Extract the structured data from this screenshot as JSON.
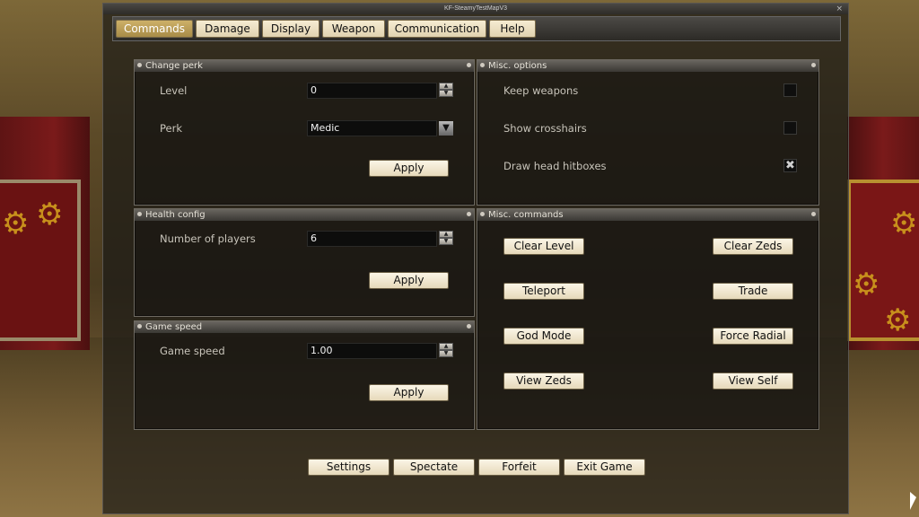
{
  "window": {
    "title": "KF-SteamyTestMapV3",
    "close_glyph": "×"
  },
  "tabs": [
    {
      "label": "Commands",
      "active": true
    },
    {
      "label": "Damage"
    },
    {
      "label": "Display"
    },
    {
      "label": "Weapon"
    },
    {
      "label": "Communication"
    },
    {
      "label": "Help"
    }
  ],
  "change_perk": {
    "title": "Change perk",
    "level_label": "Level",
    "level_value": "0",
    "perk_label": "Perk",
    "perk_value": "Medic",
    "apply_label": "Apply"
  },
  "health_config": {
    "title": "Health config",
    "players_label": "Number of players",
    "players_value": "6",
    "apply_label": "Apply"
  },
  "game_speed": {
    "title": "Game speed",
    "speed_label": "Game speed",
    "speed_value": "1.00",
    "apply_label": "Apply"
  },
  "misc_options": {
    "title": "Misc. options",
    "items": [
      {
        "label": "Keep weapons",
        "checked": false,
        "mark": ""
      },
      {
        "label": "Show crosshairs",
        "checked": false,
        "mark": ""
      },
      {
        "label": "Draw head hitboxes",
        "checked": true,
        "mark": "✖"
      }
    ]
  },
  "misc_commands": {
    "title": "Misc. commands",
    "buttons": [
      "Clear Level",
      "Clear Zeds",
      "Teleport",
      "Trade",
      "God Mode",
      "Force Radial",
      "View Zeds",
      "View Self"
    ]
  },
  "footer": {
    "buttons": [
      "Settings",
      "Spectate",
      "Forfeit",
      "Exit Game"
    ]
  },
  "icons": {
    "spin_up": "▲",
    "spin_down": "▼",
    "dropdown": "▼",
    "gear": "⚙"
  },
  "colors": {
    "accent_tab": "#a88c48",
    "button_face": "#f0e6cc",
    "panel_bg": "#141311"
  }
}
